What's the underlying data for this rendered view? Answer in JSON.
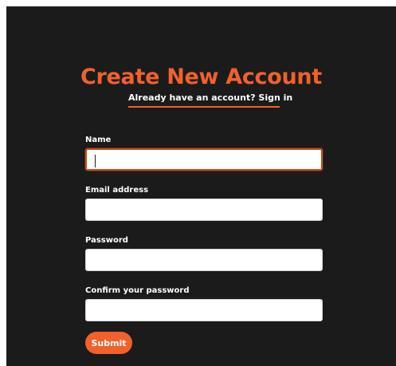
{
  "form": {
    "title": "Create New Account",
    "signin_link": "Already have an account? Sign in",
    "fields": [
      {
        "label": "Name",
        "value": "",
        "placeholder": ""
      },
      {
        "label": "Email address",
        "value": "",
        "placeholder": ""
      },
      {
        "label": "Password",
        "value": "",
        "placeholder": ""
      },
      {
        "label": "Confirm your password",
        "value": "",
        "placeholder": ""
      }
    ],
    "submit_label": "Submit"
  },
  "colors": {
    "background": "#1c1b1b",
    "accent": "#f0612b",
    "text": "#ffffff",
    "input_background": "#ffffff"
  }
}
